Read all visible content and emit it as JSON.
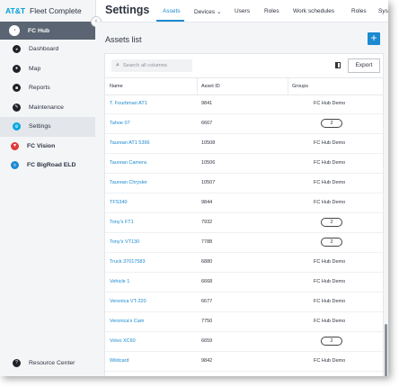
{
  "brand": {
    "att": "AT&T",
    "name": "Fleet Complete"
  },
  "sidebar": {
    "hub": "FC Hub",
    "items": [
      {
        "label": "Dashboard",
        "icon": "dashboard-icon"
      },
      {
        "label": "Map",
        "icon": "map-icon"
      },
      {
        "label": "Reports",
        "icon": "reports-icon"
      },
      {
        "label": "Maintenance",
        "icon": "maintenance-icon"
      },
      {
        "label": "Settings",
        "icon": "settings-icon"
      }
    ],
    "apps": [
      {
        "label": "FC Vision",
        "icon": "fc-vision-icon"
      },
      {
        "label": "FC BigRoad ELD",
        "icon": "bigroad-icon"
      }
    ],
    "resource_center": "Resource Center"
  },
  "header": {
    "title": "Settings",
    "tabs": [
      "Assets",
      "Devices",
      "Users",
      "Roles",
      "Work schedules",
      "Roles",
      "Sys"
    ]
  },
  "page": {
    "title": "Assets list",
    "search_placeholder": "Search all columns",
    "export_label": "Export"
  },
  "table": {
    "columns": [
      "Name",
      "Asset ID",
      "Groups"
    ],
    "rows": [
      {
        "name": "T. Fourbman AT1",
        "id": "9841",
        "group": "FC Hub Demo",
        "pill": ""
      },
      {
        "name": "Tahoe 07",
        "id": "6667",
        "group": "",
        "pill": "2"
      },
      {
        "name": "Taurean AT1 5396",
        "id": "10508",
        "group": "FC Hub Demo",
        "pill": ""
      },
      {
        "name": "Taurean Camera",
        "id": "10506",
        "group": "FC Hub Demo",
        "pill": ""
      },
      {
        "name": "Taurean Chrysler",
        "id": "10507",
        "group": "FC Hub Demo",
        "pill": ""
      },
      {
        "name": "TFS340",
        "id": "9844",
        "group": "FC Hub Demo",
        "pill": ""
      },
      {
        "name": "Tony's FT1",
        "id": "7932",
        "group": "",
        "pill": "2"
      },
      {
        "name": "Tony's VT130",
        "id": "7788",
        "group": "",
        "pill": "2"
      },
      {
        "name": "Truck 37017583",
        "id": "6880",
        "group": "FC Hub Demo",
        "pill": ""
      },
      {
        "name": "Vehicle 1",
        "id": "6668",
        "group": "FC Hub Demo",
        "pill": ""
      },
      {
        "name": "Veronica VT-220",
        "id": "6677",
        "group": "FC Hub Demo",
        "pill": ""
      },
      {
        "name": "Veronica's Cam",
        "id": "7750",
        "group": "FC Hub Demo",
        "pill": ""
      },
      {
        "name": "Volvo XC60",
        "id": "6659",
        "group": "",
        "pill": "2"
      },
      {
        "name": "Wildcard",
        "id": "9842",
        "group": "FC Hub Demo",
        "pill": ""
      },
      {
        "name": "",
        "id": "",
        "group": "",
        "pill": ""
      }
    ]
  },
  "colors": {
    "accent": "#1b8ad0",
    "att_blue": "#009fdb",
    "hub_bg": "#5a6472"
  }
}
